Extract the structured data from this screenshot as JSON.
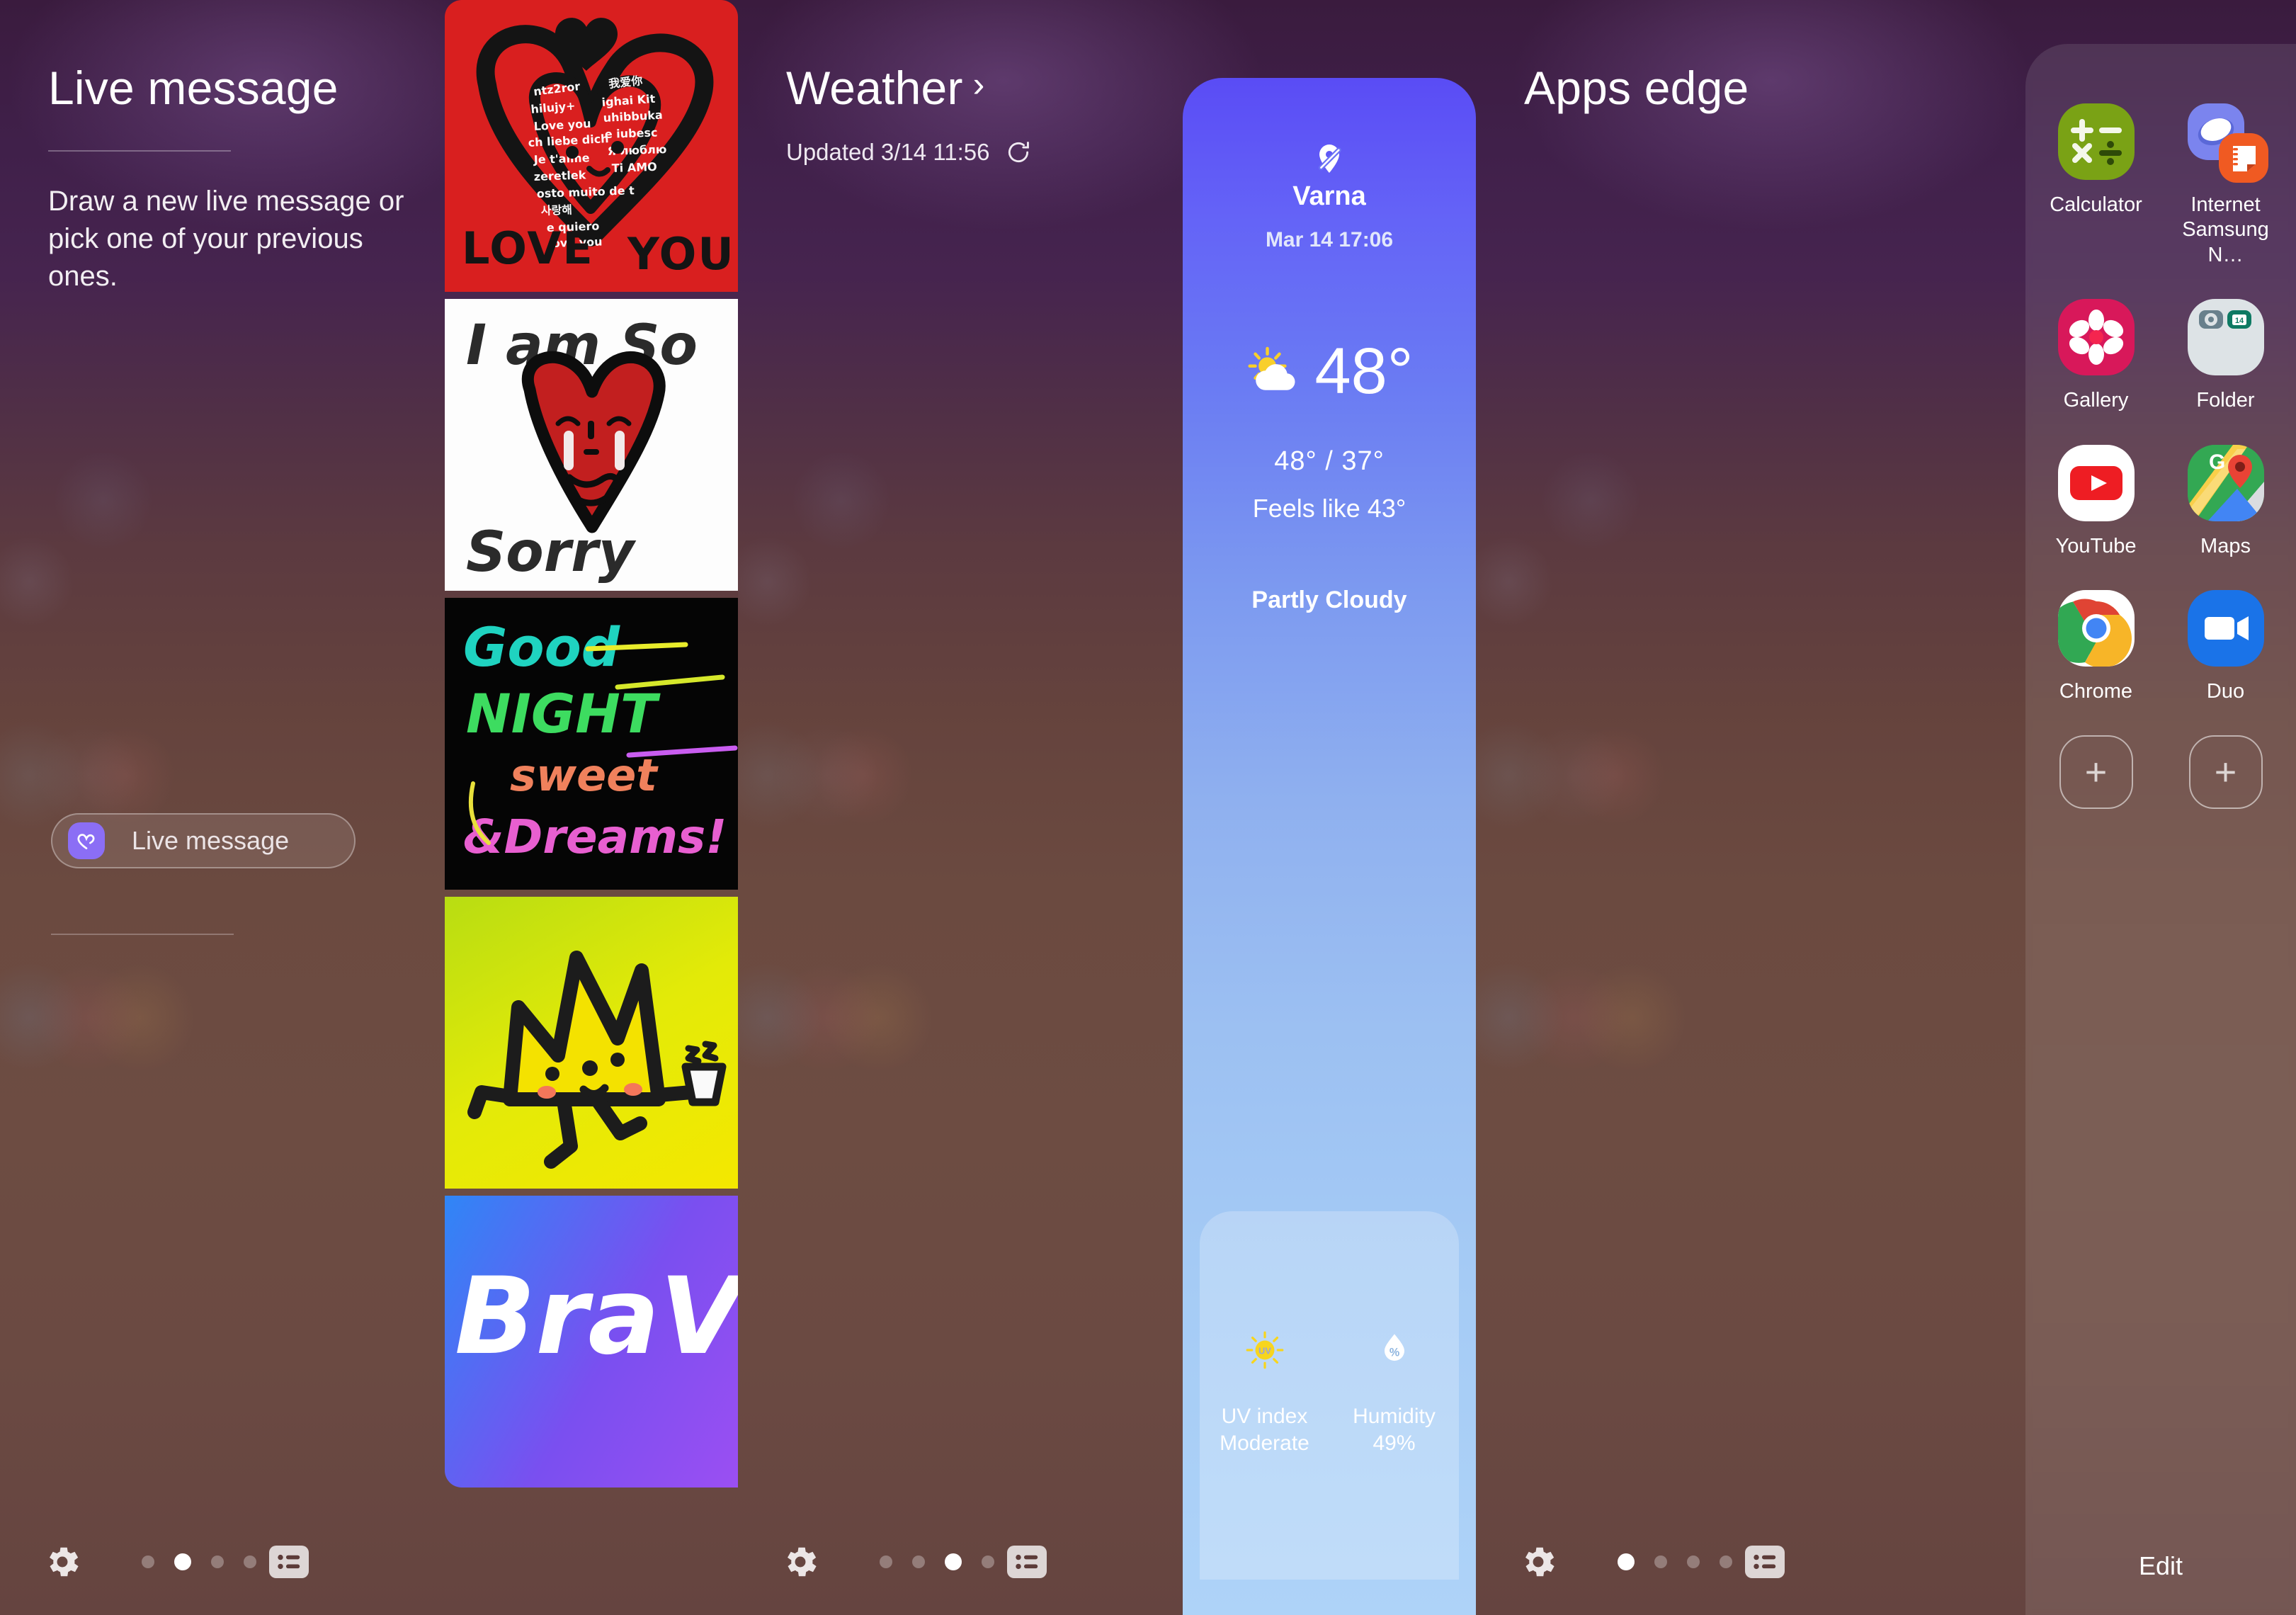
{
  "panels": [
    {
      "id": "live-message",
      "title": "Live message",
      "subtitle": "Draw a new live message or pick one of your previous ones.",
      "button_label": "Live message",
      "button_icon": "heart-outline-icon",
      "thumbnails": [
        {
          "name": "love-you",
          "caption": "LOVE YOU"
        },
        {
          "name": "i-am-so-sorry",
          "caption_top": "I am So",
          "caption_bottom": "Sorry"
        },
        {
          "name": "good-night-sweet-dreams",
          "l1": "Good",
          "l2": "NIGHT",
          "l3": "sweet",
          "l4": "&Dreams!"
        },
        {
          "name": "crown-character",
          "caption": ""
        },
        {
          "name": "bravo",
          "caption": "BraVo!"
        }
      ],
      "nav": {
        "gear_icon": "gear-icon",
        "list_icon": "list-icon",
        "dots": 4,
        "active_dot": 2
      }
    },
    {
      "id": "weather",
      "title": "Weather",
      "chevron": "›",
      "updated": "Updated 3/14 11:56",
      "refresh_icon": "refresh-icon",
      "card": {
        "location_icon": "location-off-icon",
        "city": "Varna",
        "datetime": "Mar 14 17:06",
        "condition_icon": "partly-cloudy-icon",
        "temperature": "48°",
        "high_low": "48° / 37°",
        "feels_like": "Feels like 43°",
        "condition": "Partly Cloudy",
        "metrics": [
          {
            "icon": "uv-sun-icon",
            "label": "UV index",
            "value": "Moderate"
          },
          {
            "icon": "humidity-drop-icon",
            "label": "Humidity",
            "value": "49%"
          }
        ]
      },
      "nav": {
        "gear_icon": "gear-icon",
        "list_icon": "list-icon",
        "dots": 4,
        "active_dot": 3
      }
    },
    {
      "id": "apps-edge",
      "title": "Apps edge",
      "edit_label": "Edit",
      "apps": [
        {
          "name": "calculator",
          "label": "Calculator"
        },
        {
          "name": "internet-samsung-notes",
          "label": "Internet Samsung N…"
        },
        {
          "name": "gallery",
          "label": "Gallery"
        },
        {
          "name": "folder",
          "label": "Folder"
        },
        {
          "name": "youtube",
          "label": "YouTube"
        },
        {
          "name": "maps",
          "label": "Maps"
        },
        {
          "name": "chrome",
          "label": "Chrome"
        },
        {
          "name": "duo",
          "label": "Duo"
        },
        {
          "name": "add-slot-1",
          "label": ""
        },
        {
          "name": "add-slot-2",
          "label": ""
        }
      ],
      "add_symbol": "+",
      "nav": {
        "gear_icon": "gear-icon",
        "list_icon": "list-icon",
        "dots": 4,
        "active_dot": 1
      }
    }
  ],
  "colors": {
    "accent_purple": "#8b6ef5",
    "weather_card_top": "#5a4cf5",
    "weather_card_bottom": "#aed3f8",
    "calculator_green": "#7aa215",
    "gallery_red": "#d8185a",
    "internet_blue": "#7b84ee",
    "notes_orange": "#f05a22",
    "youtube_red": "#ee1d23",
    "maps_green": "#33a853",
    "duo_blue": "#1a73e8",
    "wallpaper_top": "#3a1b3e",
    "wallpaper_bottom": "#6d4c42"
  }
}
